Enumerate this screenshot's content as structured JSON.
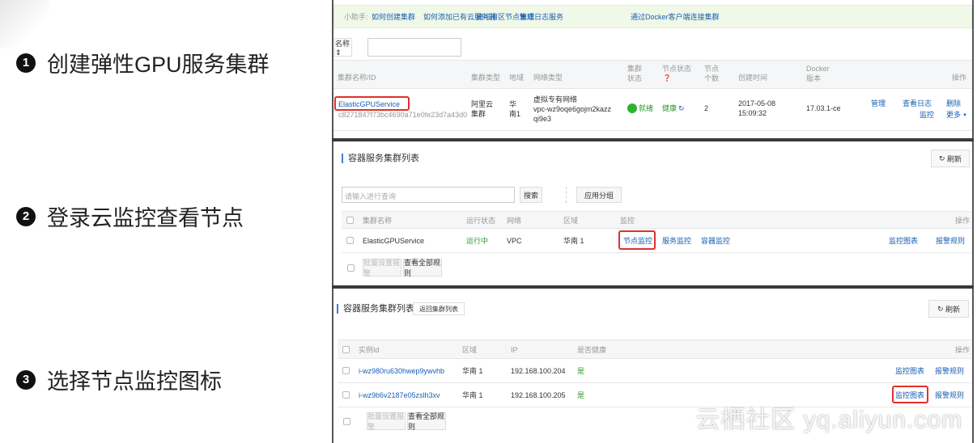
{
  "steps": [
    {
      "num": "1",
      "label": "创建弹性GPU服务集群"
    },
    {
      "num": "2",
      "label": "登录云监控查看节点"
    },
    {
      "num": "3",
      "label": "选择节点监控图标"
    }
  ],
  "panel1": {
    "helper_label": "小助手:",
    "helper_links": [
      "如何创建集群",
      "如何添加已有云服务器",
      "跨可用区节点管理",
      "集成日志服务",
      "通过Docker客户端连接集群"
    ],
    "filter_select": "名称 ⇕",
    "filter_value": "",
    "columns": [
      "集群名称/ID",
      "集群类型",
      "地域",
      "网络类型",
      "集群状态",
      "节点状态",
      "节点个数",
      "创建时间",
      "Docker版本",
      "操作"
    ],
    "row": {
      "name": "ElasticGPUService",
      "id": "c8271847f73bc4690a71e0fe23d7a43d0",
      "type": "阿里云集群",
      "region": "华南1",
      "network": "虚拟专有网络",
      "vpc": "vpc-wz9oqe6gojm2kazzqi9e3",
      "status": "就绪",
      "node_status": "健康",
      "nodes": "2",
      "created_date": "2017-05-08",
      "created_time": "15:09:32",
      "docker": "17.03.1-ce",
      "actions": [
        "管理",
        "查看日志",
        "删除",
        "监控",
        "更多"
      ]
    },
    "status_color": "#2bb52b"
  },
  "panel2": {
    "title": "容器服务集群列表",
    "refresh": "刷新",
    "search_placeholder": "请输入进行查询",
    "search_btn": "搜索",
    "group_btn": "应用分组",
    "columns": [
      "集群名称",
      "运行状态",
      "网络",
      "区域",
      "监控",
      "操作"
    ],
    "row": {
      "name": "ElasticGPUService",
      "status": "运行中",
      "network": "VPC",
      "region": "华南 1",
      "monitor": [
        "节点监控",
        "服务监控",
        "容器监控"
      ],
      "actions": [
        "监控图表",
        "报警规则"
      ]
    },
    "batch_btn": "批量设置报警",
    "rules_btn": "查看全部规则"
  },
  "panel3": {
    "title": "容器服务集群列表",
    "back_btn": "返回集群列表",
    "refresh": "刷新",
    "columns": [
      "实例Id",
      "区域",
      "IP",
      "是否健康",
      "操作"
    ],
    "rows": [
      {
        "id": "i-wz980ru630hwep9ywvhb",
        "region": "华南 1",
        "ip": "192.168.100.204",
        "healthy": "是",
        "actions": [
          "监控图表",
          "报警规则"
        ]
      },
      {
        "id": "i-wz9b6v2187e05zslh3xv",
        "region": "华南 1",
        "ip": "192.168.100.205",
        "healthy": "是",
        "actions": [
          "监控图表",
          "报警规则"
        ]
      }
    ],
    "batch_btn": "批量设置报警",
    "rules_btn": "查看全部规则"
  },
  "watermark": "云栖社区 yq.aliyun.com"
}
